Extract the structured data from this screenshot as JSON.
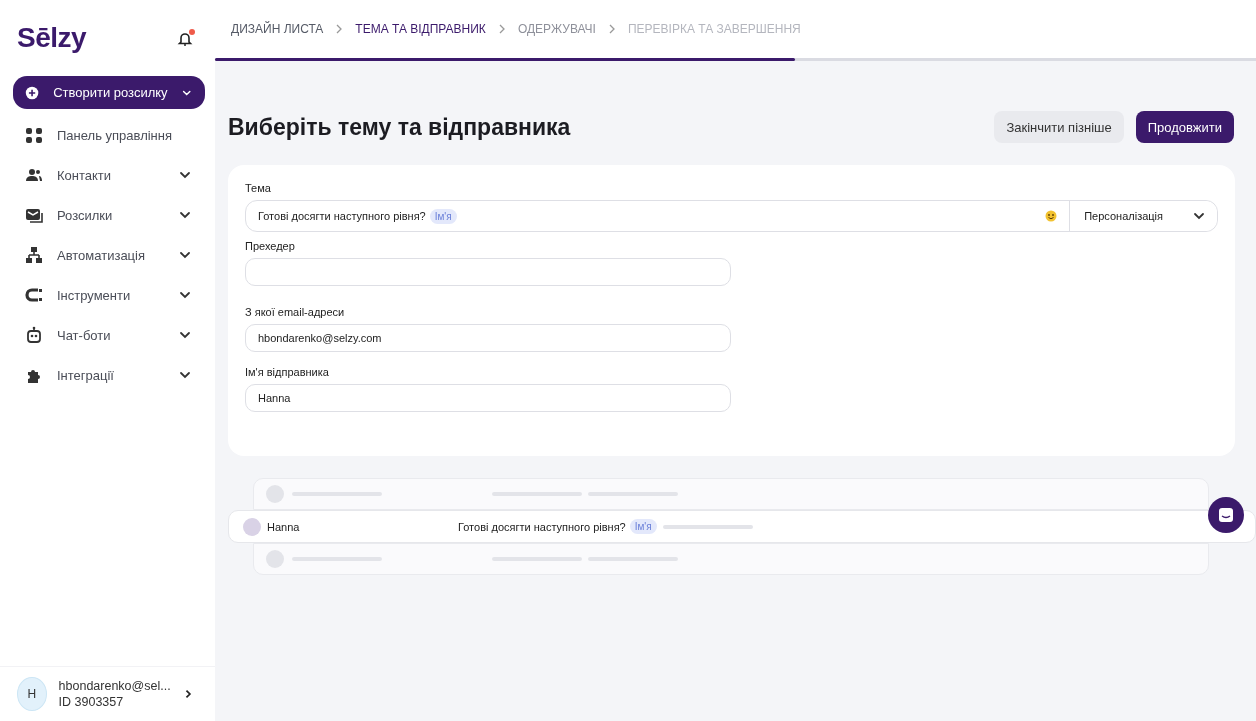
{
  "sidebar": {
    "logo": "Sēlzy",
    "notification_dot": true,
    "items": [
      {
        "label": "Створити розсилку",
        "kind": "primary",
        "has_submenu": true
      },
      {
        "label": "Панель управління",
        "kind": "item",
        "has_submenu": false
      },
      {
        "label": "Контакти",
        "kind": "item",
        "has_submenu": true
      },
      {
        "label": "Розсилки",
        "kind": "item",
        "has_submenu": true
      },
      {
        "label": "Автоматизація",
        "kind": "item",
        "has_submenu": true
      },
      {
        "label": "Інструменти",
        "kind": "item",
        "has_submenu": true
      },
      {
        "label": "Чат-боти",
        "kind": "item",
        "has_submenu": true
      },
      {
        "label": "Інтеграції",
        "kind": "item",
        "has_submenu": true
      }
    ],
    "account": {
      "avatar": "H",
      "email": "hbondarenko@sel...",
      "id": "ID 3903357"
    }
  },
  "steps": {
    "items": [
      {
        "label": "ДИЗАЙН ЛИСТА",
        "selected": false,
        "completed": true,
        "disabled": false
      },
      {
        "label": "ТЕМА ТА ВІДПРАВНИК",
        "selected": true,
        "completed": false,
        "disabled": false
      },
      {
        "label": "ОДЕРЖУВАЧІ",
        "selected": false,
        "completed": false,
        "disabled": false
      },
      {
        "label": "ПЕРЕВІРКА ТА ЗАВЕРШЕННЯ",
        "selected": false,
        "completed": false,
        "disabled": true
      }
    ],
    "level": 0.557
  },
  "page": {
    "title": "Виберіть тему та відправника",
    "buttons": [
      {
        "label": "Закінчити пізніше",
        "kind": "secondary"
      },
      {
        "label": "Продовжити",
        "kind": "primary"
      }
    ]
  },
  "form": {
    "subject": {
      "label": "Тема",
      "value": "Готові досягти наступного рівня?",
      "token": "Ім'я",
      "personalization": "Персоналізація"
    },
    "fields": [
      {
        "label": "Прехедер"
      },
      {
        "label": "З якої email-адреси",
        "value": "hbondarenko@selzy.com"
      },
      {
        "label": "Ім'я відправника",
        "value": "Hanna"
      }
    ]
  },
  "preview": {
    "sender": "Hanna",
    "subject": "Готові досягти наступного рівня?",
    "token": "Ім'я"
  }
}
